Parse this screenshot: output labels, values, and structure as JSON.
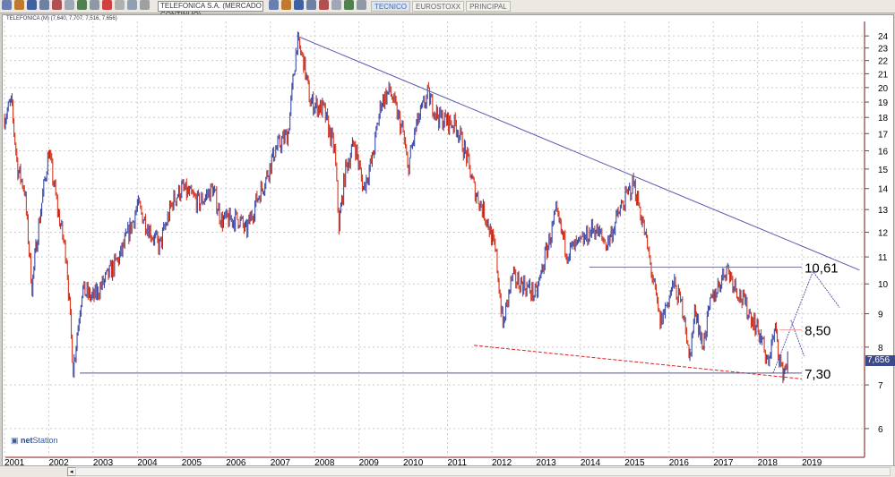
{
  "toolbar": {
    "symbol": "TELEFONICA S.A. (MERCADO CONTINUO)",
    "tabs": [
      "TECNICO",
      "EUROSTOXX",
      "PRINCIPAL"
    ],
    "active_tab": "TECNICO"
  },
  "chart_header": "TELEFONICA (M) (7,640, 7,707, 7,516, 7,656)",
  "logo": {
    "prefix": "net",
    "suffix": "Station"
  },
  "last_price_label": "7,656",
  "colors": {
    "up": "#3a4aa8",
    "down": "#d8361e",
    "trend": "#5a5ab0",
    "support": "#555577",
    "red_dashed": "#e02020",
    "pink": "#f0a0a0"
  },
  "chart_data": {
    "type": "line",
    "title": "TELEFONICA (M)",
    "scale": "log",
    "ylim": [
      5.4,
      25.5
    ],
    "yticks": [
      6,
      7,
      8,
      9,
      10,
      11,
      12,
      13,
      14,
      15,
      16,
      17,
      18,
      19,
      20,
      21,
      22,
      23,
      24
    ],
    "xticks": [
      "2001",
      "2002",
      "2003",
      "2004",
      "2005",
      "2006",
      "2007",
      "2008",
      "2009",
      "2010",
      "2011",
      "2012",
      "2013",
      "2014",
      "2015",
      "2016",
      "2017",
      "2018",
      "2019"
    ],
    "xlim": [
      2001,
      2021.5
    ],
    "price_path": [
      [
        2001.0,
        18
      ],
      [
        2001.15,
        19
      ],
      [
        2001.3,
        15
      ],
      [
        2001.45,
        14
      ],
      [
        2001.62,
        9.9
      ],
      [
        2001.75,
        12
      ],
      [
        2002.0,
        16
      ],
      [
        2002.2,
        13
      ],
      [
        2002.4,
        11
      ],
      [
        2002.55,
        7.4
      ],
      [
        2002.75,
        9.8
      ],
      [
        2003.0,
        9.5
      ],
      [
        2003.3,
        10.2
      ],
      [
        2003.6,
        11
      ],
      [
        2003.9,
        12.5
      ],
      [
        2004.0,
        13.2
      ],
      [
        2004.3,
        12
      ],
      [
        2004.5,
        11.4
      ],
      [
        2004.8,
        13.4
      ],
      [
        2005.0,
        14
      ],
      [
        2005.4,
        13.3
      ],
      [
        2005.7,
        14
      ],
      [
        2005.9,
        12.5
      ],
      [
        2006.3,
        12.6
      ],
      [
        2006.45,
        12
      ],
      [
        2006.7,
        13.5
      ],
      [
        2006.9,
        14.5
      ],
      [
        2007.1,
        16
      ],
      [
        2007.4,
        17
      ],
      [
        2007.6,
        23.5
      ],
      [
        2007.75,
        22
      ],
      [
        2007.9,
        19
      ],
      [
        2008.2,
        18.5
      ],
      [
        2008.45,
        16
      ],
      [
        2008.55,
        12.3
      ],
      [
        2008.7,
        15
      ],
      [
        2008.9,
        16.5
      ],
      [
        2009.1,
        14
      ],
      [
        2009.3,
        15.5
      ],
      [
        2009.5,
        19
      ],
      [
        2009.7,
        19.8
      ],
      [
        2010.0,
        17
      ],
      [
        2010.1,
        15
      ],
      [
        2010.3,
        17.5
      ],
      [
        2010.55,
        19.5
      ],
      [
        2010.8,
        18
      ],
      [
        2011.2,
        17.5
      ],
      [
        2011.45,
        15.5
      ],
      [
        2011.6,
        14
      ],
      [
        2011.9,
        12.5
      ],
      [
        2012.1,
        11
      ],
      [
        2012.25,
        8.6
      ],
      [
        2012.45,
        10.2
      ],
      [
        2012.7,
        10
      ],
      [
        2013.0,
        9.6
      ],
      [
        2013.2,
        11
      ],
      [
        2013.45,
        12.8
      ],
      [
        2013.7,
        11.2
      ],
      [
        2014.0,
        11.5
      ],
      [
        2014.3,
        12.2
      ],
      [
        2014.6,
        11.5
      ],
      [
        2014.9,
        13
      ],
      [
        2015.2,
        14.3
      ],
      [
        2015.4,
        12.5
      ],
      [
        2015.6,
        10.5
      ],
      [
        2015.8,
        8.7
      ],
      [
        2016.1,
        10
      ],
      [
        2016.35,
        9
      ],
      [
        2016.45,
        7.6
      ],
      [
        2016.6,
        9.2
      ],
      [
        2016.75,
        8
      ],
      [
        2016.95,
        9.4
      ],
      [
        2017.3,
        10.6
      ],
      [
        2017.6,
        9.6
      ],
      [
        2017.9,
        8.8
      ],
      [
        2018.1,
        8.2
      ],
      [
        2018.2,
        7.5
      ],
      [
        2018.4,
        8.5
      ],
      [
        2018.55,
        7.3
      ],
      [
        2018.7,
        7.66
      ]
    ],
    "annotations": [
      {
        "label": "10,61",
        "value": 10.61,
        "from": 2014.2,
        "to": 2019.0,
        "color": "#777799"
      },
      {
        "label": "8,50",
        "value": 8.5,
        "from": 2018.5,
        "to": 2019.0,
        "color": "#f0a0a0"
      },
      {
        "label": "7,30",
        "value": 7.3,
        "from": 2002.7,
        "to": 2019.0,
        "color": "#555577"
      }
    ],
    "trendlines": [
      {
        "name": "resistance",
        "points": [
          [
            2007.6,
            24
          ],
          [
            2020.3,
            10.5
          ]
        ],
        "color": "#5a5ab0",
        "dash": ""
      },
      {
        "name": "support-red",
        "points": [
          [
            2011.6,
            8.05
          ],
          [
            2019.0,
            7.15
          ]
        ],
        "color": "#e02020",
        "dash": "4,2"
      },
      {
        "name": "projection",
        "points": [
          [
            2018.35,
            7.3
          ],
          [
            2019.25,
            10.45
          ],
          [
            2019.85,
            9.2
          ]
        ],
        "color": "#5a5ab0",
        "dash": "2,1"
      },
      {
        "name": "projection-short",
        "points": [
          [
            2018.75,
            8.8
          ],
          [
            2019.05,
            7.75
          ]
        ],
        "color": "#5a5ab0",
        "dash": "2,1"
      }
    ]
  }
}
